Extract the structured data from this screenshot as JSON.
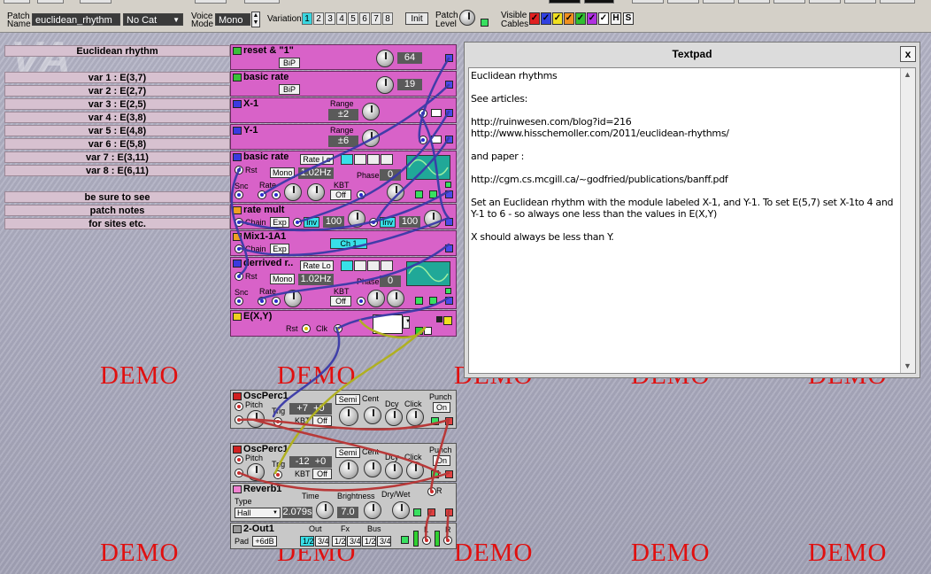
{
  "toolbar": {
    "patch_name_label_1": "Patch",
    "patch_name_label_2": "Name",
    "patch_name_value": "euclidean_rhythm",
    "category_value": "No Cat",
    "voice_mode_label_1": "Voice",
    "voice_mode_label_2": "Mode",
    "voice_mode_value": "Mono",
    "variation_label": "Variation",
    "variation_buttons": [
      "1",
      "2",
      "3",
      "4",
      "5",
      "6",
      "7",
      "8"
    ],
    "active_variation": "1",
    "init_label": "Init",
    "patch_level_label_1": "Patch",
    "patch_level_label_2": "Level",
    "visible_cables_label_1": "Visible",
    "visible_cables_label_2": "Cables",
    "cable_h": "H",
    "cable_s": "S",
    "cable_colors": [
      "#e02020",
      "#3040e0",
      "#f0e020",
      "#f09020",
      "#30c030",
      "#b030e0",
      "#ffffff"
    ]
  },
  "labels": [
    "Euclidean rhythm",
    "var 1 : E(3,7)",
    "var 2 : E(2,7)",
    "var 3 : E(2,5)",
    "var 4 : E(3,8)",
    "var 5 : E(4,8)",
    "var 6 : E(5,8)",
    "var 7 : E(3,11)",
    "var 8 : E(6,11)",
    "be sure to see",
    "patch notes",
    "for sites etc."
  ],
  "modules": {
    "reset": {
      "title": "reset & \"1\"",
      "bip": "BiP",
      "value": "64"
    },
    "basic_rate": {
      "title": "basic rate",
      "bip": "BiP",
      "value": "19"
    },
    "x1": {
      "title": "X-1",
      "range_label": "Range",
      "range_value": "±2"
    },
    "y1": {
      "title": "Y-1",
      "range_label": "Range",
      "range_value": "±6"
    },
    "basic_rate_lfo": {
      "title": "basic rate",
      "rate_mode": "Rate Lo",
      "rst": "Rst",
      "mono": "Mono",
      "freq": "1.02Hz",
      "phase_label": "Phase",
      "phase_value": "0",
      "snc": "Snc",
      "rate": "Rate",
      "kbt": "KBT",
      "kbt_value": "Off"
    },
    "rate_mult": {
      "title": "rate mult",
      "chain": "Chain",
      "exp": "Exp",
      "inv1": "Inv",
      "val1": "100",
      "inv2": "Inv",
      "val2": "100"
    },
    "mix": {
      "title": "Mix1-1A1",
      "chain": "Chain",
      "exp": "Exp",
      "ch": "Ch 1"
    },
    "derived": {
      "title": "derrived r..",
      "rate_mode": "Rate Lo",
      "rst": "Rst",
      "mono": "Mono",
      "freq": "1.02Hz",
      "phase_label": "Phase",
      "phase_value": "0",
      "snc": "Snc",
      "rate": "Rate",
      "kbt": "KBT",
      "kbt_value": "Off"
    },
    "exy": {
      "title": "E(X,Y)",
      "rst": "Rst",
      "clk": "Clk"
    },
    "osc1": {
      "title": "OscPerc1",
      "pitch": "Pitch",
      "trig": "Trig",
      "semi": "Semi",
      "cent": "Cent",
      "dcy": "Dcy",
      "click": "Click",
      "punch": "Punch",
      "punch_value": "On",
      "disp1": "+7",
      "disp2": "+0",
      "kbt": "KBT",
      "kbt_value": "Off"
    },
    "osc2": {
      "title": "OscPerc1",
      "pitch": "Pitch",
      "trig": "Trig",
      "semi": "Semi",
      "cent": "Cent",
      "dcy": "Dcy",
      "click": "Click",
      "punch": "Punch",
      "punch_value": "On",
      "disp1": "-12",
      "disp2": "+0",
      "kbt": "KBT",
      "kbt_value": "Off"
    },
    "reverb": {
      "title": "Reverb1",
      "type_label": "Type",
      "type_value": "Hall",
      "time_label": "Time",
      "time_value": "2.079s",
      "brightness_label": "Brightness",
      "brightness_value": "7.0",
      "drywet_label": "Dry/Wet",
      "r": "R"
    },
    "out": {
      "title": "2-Out1",
      "out_label": "Out",
      "fx_label": "Fx",
      "bus_label": "Bus",
      "pad_label": "Pad",
      "pad_value": "+6dB",
      "out_opts": [
        "1/2",
        "3/4"
      ],
      "fx_opts": [
        "1/2",
        "3/4"
      ],
      "bus_opts": [
        "1/2",
        "3/4"
      ],
      "l": "L",
      "r": "R"
    }
  },
  "textpad": {
    "title": "Textpad",
    "close": "x",
    "lines": [
      "Euclidean rhythms",
      "",
      "See articles:",
      "",
      "http://ruinwesen.com/blog?id=216",
      "http://www.hisschemoller.com/2011/euclidean-rhythms/",
      "",
      "and paper :",
      "",
      "http://cgm.cs.mcgill.ca/~godfried/publications/banff.pdf",
      "",
      "Set an Euclidean rhythm with the module labeled X-1, and Y-1. To set E(5,7) set X-1to 4 and Y-1 to 6 - so always one less than the values in E(X,Y)",
      "",
      "X should always be less than Y."
    ]
  },
  "watermark": "DEMO",
  "watermark_bg": "VA"
}
